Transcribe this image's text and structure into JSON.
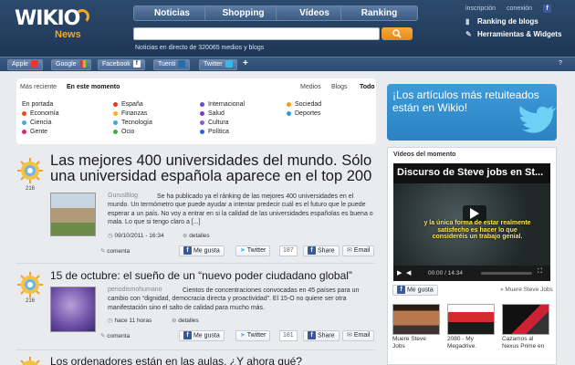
{
  "header": {
    "logo_word": "WIKIO",
    "logo_sub": "News",
    "nav": [
      "Noticias",
      "Shopping",
      "Vídeos",
      "Ranking"
    ],
    "search": {
      "placeholder": ""
    },
    "tagline": "Noticias en directo de 320065 medios y blogs",
    "top_links": [
      "inscripción",
      "conexión"
    ],
    "side_links": [
      "Ranking de blogs",
      "Herramientas & Widgets"
    ]
  },
  "sharebar": {
    "items": [
      "Apple",
      "Google",
      "Facebook",
      "Tuenti",
      "Twitter"
    ],
    "add": "+",
    "help": "?"
  },
  "filters": {
    "left": [
      "Más reciente",
      "En este momento"
    ],
    "right": [
      "Medios",
      "Blogs",
      "Todo"
    ]
  },
  "categories": [
    {
      "label": "En portada",
      "color": ""
    },
    {
      "label": "Economía",
      "color": "#e54b1f"
    },
    {
      "label": "Ciencia",
      "color": "#4aa8e0"
    },
    {
      "label": "Gente",
      "color": "#d02a74"
    },
    {
      "label": "España",
      "color": "#e5342a"
    },
    {
      "label": "Finanzas",
      "color": "#f0b41c"
    },
    {
      "label": "Tecnología",
      "color": "#39a7d8"
    },
    {
      "label": "Ocio",
      "color": "#3fa94b"
    },
    {
      "label": "Internacional",
      "color": "#6a4bd0"
    },
    {
      "label": "Salud",
      "color": "#7a3bc4"
    },
    {
      "label": "Cultura",
      "color": "#8e5ad6"
    },
    {
      "label": "Política",
      "color": "#2f62d0"
    },
    {
      "label": "Sociedad",
      "color": "#f29b1c"
    },
    {
      "label": "Deportes",
      "color": "#2e9bd6"
    }
  ],
  "articles": [
    {
      "score": "216",
      "title": "Las mejores 400 universidades del mundo. Sólo una universidad española aparece en el top 200",
      "source": "GurusBlog",
      "desc": "Se ha publicado ya el ránking de las mejores 400 universidades en el mundo. Un termómetro que puede ayudar a intentar predecir cuál es el futuro que le puede esperar a un país. No voy a entrar en si la calidad de las universidades españolas es buena o mala. Lo que si tengo claro a [...]",
      "time": "09/10/2011 - 16:34",
      "details": "detalles",
      "comment": "comenta",
      "like": "Me gusta",
      "twitter": "Twitter",
      "twitter_count": "187",
      "share": "Share",
      "email": "Email"
    },
    {
      "score": "216",
      "title": "15 de octubre: el sueño de un “nuevo poder ciudadano global”",
      "source": "periodismohumano",
      "desc": "Cientos de concentraciones convocadas en 45 países para un cambio con “dignidad, democracia directa y proactividad”. El 15-O no quiere ser otra manifestación sino el salto de calidad para mucho más.",
      "time": "hace 11 horas",
      "details": "detalles",
      "comment": "comenta",
      "like": "Me gusta",
      "twitter": "Twitter",
      "twitter_count": "181",
      "share": "Share",
      "email": "Email"
    },
    {
      "title": "Los ordenadores están en las aulas. ¿Y ahora qué?"
    }
  ],
  "promo": {
    "text": "¡Los artículos más retuiteados están en Wikio!"
  },
  "videos": {
    "heading": "Vídeos del momento",
    "player_title": "Discurso de Steve jobs en St...",
    "caption": "y la única forma de estar realmente satisfecho es hacer lo que consideréis un trabajo genial.",
    "time": "00:00 / 14:34",
    "like": "Me gusta",
    "more": "» Muere Steve Jobs",
    "thumbs": [
      "Muere Steve Jobs",
      "2080 - My Megadrive.",
      "Cazamos al Nexus Prime en"
    ]
  },
  "colors": {
    "header": "#1d3654",
    "accent": "#f5a623",
    "promo": "#3e9bd9"
  }
}
